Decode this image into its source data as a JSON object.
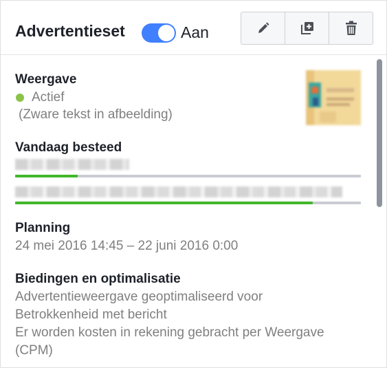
{
  "header": {
    "title": "Advertentieset",
    "toggle_label": "Aan",
    "toggle_on": true,
    "accent_color": "#4080ff",
    "actions": [
      {
        "icon": "pencil-icon",
        "name": "edit-button"
      },
      {
        "icon": "duplicate-icon",
        "name": "duplicate-button"
      },
      {
        "icon": "trash-icon",
        "name": "delete-button"
      }
    ]
  },
  "delivery": {
    "title": "Weergave",
    "status": "Actief",
    "status_color": "#8bc34a",
    "note": "(Zware tekst in afbeelding)"
  },
  "spend": {
    "title": "Vandaag besteed",
    "progress_1": 0.18,
    "progress_2": 0.86,
    "progress_color": "#42b72a"
  },
  "schedule": {
    "title": "Planning",
    "range": "24 mei 2016 14:45 – 22 juni 2016 0:00"
  },
  "bidding": {
    "title": "Biedingen en optimalisatie",
    "line1": "Advertentieweergave geoptimaliseerd voor",
    "line2": "Betrokkenheid met bericht",
    "line3": "Er worden kosten in rekening gebracht per Weergave",
    "line4": "(CPM)"
  }
}
